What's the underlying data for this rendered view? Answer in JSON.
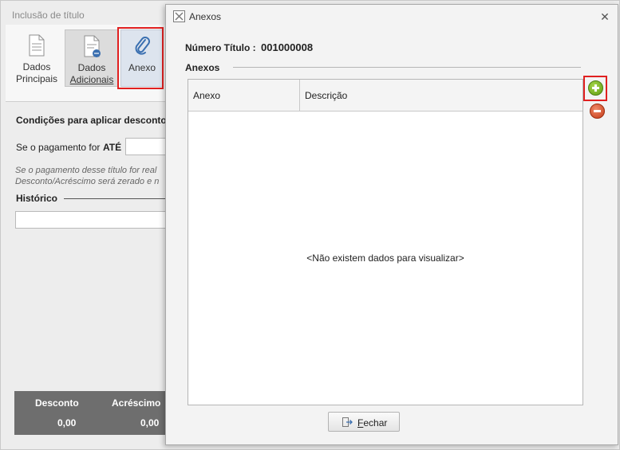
{
  "background_window": {
    "title": "Inclusão de título",
    "ribbon": {
      "btn_principais": [
        "Dados",
        "Principais"
      ],
      "btn_adicionais": [
        "Dados",
        "Adicionais"
      ],
      "btn_anexo": "Anexo"
    },
    "conditions_title": "Condições para aplicar desconto/a",
    "payment_if": "Se o pagamento for",
    "ate": "ATÉ",
    "note_line1": "Se o pagamento desse título for real",
    "note_line2": "Desconto/Acréscimo será zerado e n",
    "historico": "Histórico",
    "totals": {
      "desconto_label": "Desconto",
      "acrescimo_label": "Acréscimo",
      "desconto_value": "0,00",
      "acrescimo_value": "0,00"
    }
  },
  "dialog": {
    "title": "Anexos",
    "numero_titulo_label": "Número Título :",
    "numero_titulo_value": "001000008",
    "section_label": "Anexos",
    "columns": [
      "Anexo",
      "Descrição"
    ],
    "empty_message": "<Não existem dados para visualizar>",
    "close_button": "Fechar",
    "close_button_mnemonic": "F",
    "close_button_rest": "echar"
  },
  "icons": {
    "principais": "document-icon",
    "adicionais": "document-more-icon",
    "anexo": "paperclip-icon",
    "add": "add-circle-icon",
    "remove": "remove-circle-icon",
    "close": "close-icon",
    "fechar": "exit-icon"
  },
  "colors": {
    "highlight": "#e02020",
    "add_green": "#5e9c12",
    "remove_red": "#c43a16",
    "totals_bg": "#6e6e6e"
  }
}
